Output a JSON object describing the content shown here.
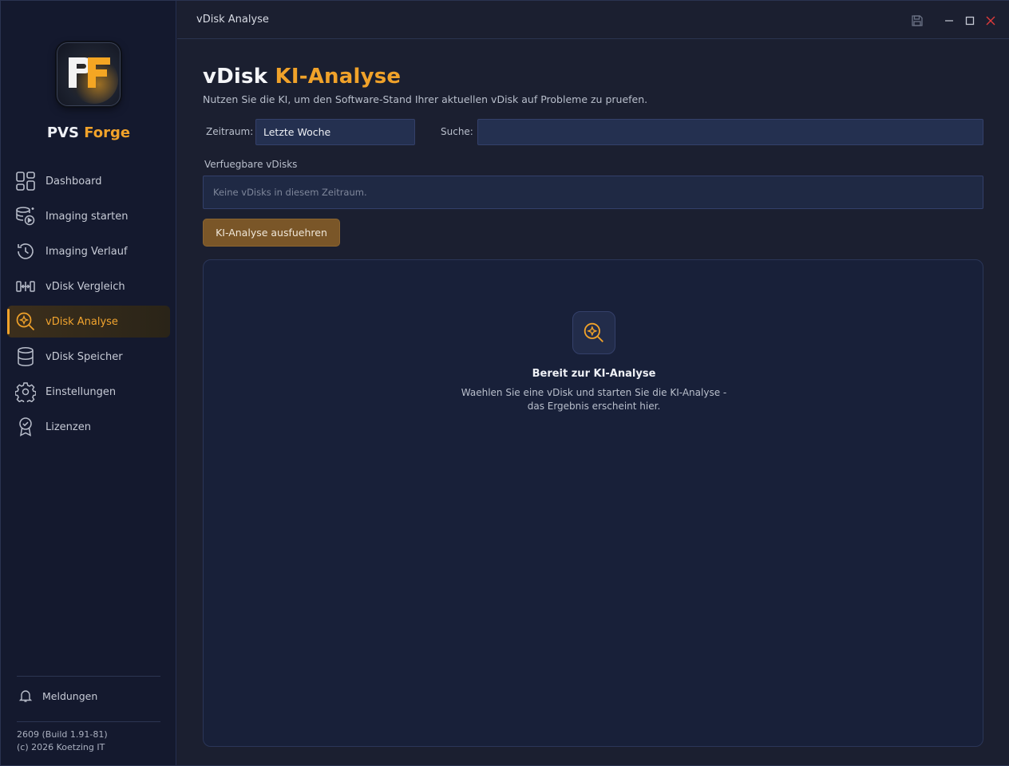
{
  "app": {
    "brand_prefix": "PVS",
    "brand_accent": "Forge",
    "window_title": "vDisk Analyse",
    "colors": {
      "accent": "#f0a22a",
      "sidebar_bg": "#14192e",
      "main_bg": "#1b1f30"
    }
  },
  "sidebar": {
    "items": [
      {
        "label": "Dashboard",
        "icon": "grid-icon"
      },
      {
        "label": "Imaging starten",
        "icon": "database-play-icon"
      },
      {
        "label": "Imaging Verlauf",
        "icon": "history-icon"
      },
      {
        "label": "vDisk Vergleich",
        "icon": "compare-icon"
      },
      {
        "label": "vDisk Analyse",
        "icon": "search-sparkle-icon",
        "active": true
      },
      {
        "label": "vDisk Speicher",
        "icon": "database-icon"
      },
      {
        "label": "Einstellungen",
        "icon": "gear-icon"
      },
      {
        "label": "Lizenzen",
        "icon": "award-icon"
      }
    ],
    "notifications_label": "Meldungen",
    "version_line1": "2609 (Build 1.91-81)",
    "version_line2": "(c) 2026 Koetzing IT"
  },
  "page": {
    "title_prefix": "vDisk",
    "title_accent": "KI-Analyse",
    "subtitle": "Nutzen Sie die KI, um den Software-Stand Ihrer aktuellen vDisk auf Probleme zu pruefen.",
    "period_label": "Zeitraum:",
    "period_value": "Letzte Woche",
    "search_label": "Suche:",
    "search_value": "",
    "vdisks_label": "Verfuegbare vDisks",
    "vdisks_empty": "Keine vDisks in diesem Zeitraum.",
    "run_button": "KI-Analyse ausfuehren",
    "ready_title": "Bereit zur KI-Analyse",
    "ready_text": "Waehlen Sie eine vDisk und starten Sie die KI-Analyse - das Ergebnis erscheint hier."
  }
}
